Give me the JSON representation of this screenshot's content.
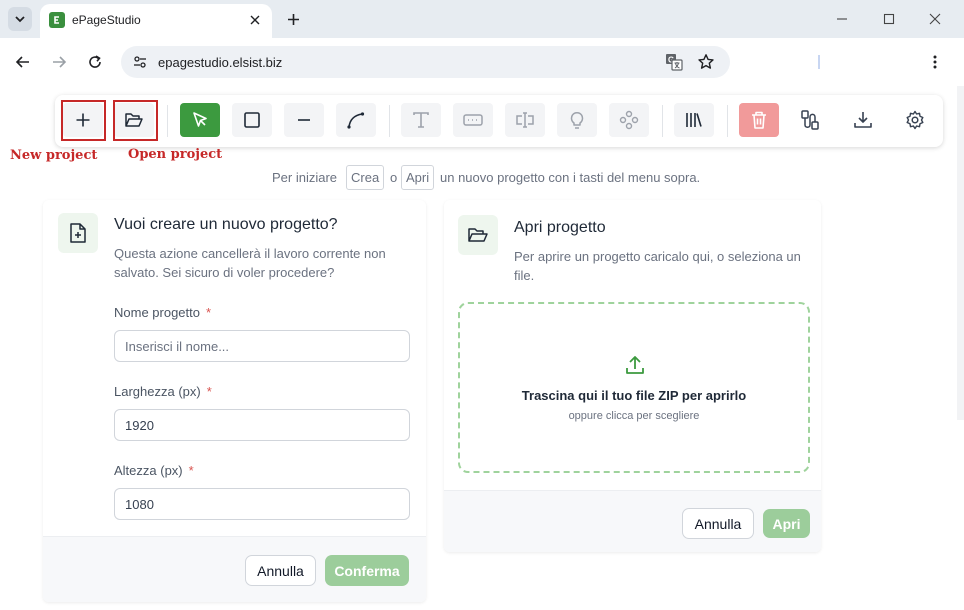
{
  "browser": {
    "tab": {
      "title": "ePageStudio"
    },
    "omnibox": {
      "url": "epagestudio.elsist.biz"
    }
  },
  "toolbar": {
    "tools": [
      {
        "name": "new-project",
        "icon": "plus-icon",
        "state": "normal"
      },
      {
        "name": "open-project",
        "icon": "folder-open-icon",
        "state": "normal"
      },
      {
        "name": "select-tool",
        "icon": "cursor-pointer-icon",
        "state": "active"
      },
      {
        "name": "rectangle-tool",
        "icon": "square-icon",
        "state": "normal"
      },
      {
        "name": "line-tool",
        "icon": "line-icon",
        "state": "normal"
      },
      {
        "name": "curve-tool",
        "icon": "curve-icon",
        "state": "normal"
      },
      {
        "name": "text-tool",
        "icon": "text-icon",
        "state": "disabled"
      },
      {
        "name": "input-field-tool",
        "icon": "input-field-icon",
        "state": "disabled"
      },
      {
        "name": "text-cursor-tool",
        "icon": "text-cursor-icon",
        "state": "disabled"
      },
      {
        "name": "lamp-tool",
        "icon": "lightbulb-icon",
        "state": "disabled"
      },
      {
        "name": "gamepad-tool",
        "icon": "gamepad-icon",
        "state": "disabled"
      },
      {
        "name": "library-tool",
        "icon": "library-icon",
        "state": "normal"
      },
      {
        "name": "delete-tool",
        "icon": "trash-icon",
        "state": "danger"
      },
      {
        "name": "connection-tool",
        "icon": "route-icon",
        "state": "normal"
      },
      {
        "name": "download-tool",
        "icon": "download-icon",
        "state": "normal"
      },
      {
        "name": "settings-tool",
        "icon": "gear-icon",
        "state": "normal"
      }
    ],
    "accent_color": "#3c9a3f",
    "danger_color": "#f19a9a"
  },
  "annotations": {
    "new_project": "New project",
    "open_project": "Open project"
  },
  "hint": {
    "prefix": "Per iniziare",
    "create_key": "Crea",
    "or": "o",
    "open_key": "Apri",
    "suffix": "un nuovo progetto con i tasti del menu sopra."
  },
  "new_project_card": {
    "title": "Vuoi creare un nuovo progetto?",
    "description": "Questa azione cancellerà il lavoro corrente non salvato. Sei sicuro di voler procedere?",
    "fields": [
      {
        "label": "Nome progetto",
        "required_mark": "*",
        "value": "",
        "placeholder": "Inserisci il nome..."
      },
      {
        "label": "Larghezza (px)",
        "required_mark": "*",
        "value": "1920",
        "placeholder": ""
      },
      {
        "label": "Altezza (px)",
        "required_mark": "*",
        "value": "1080",
        "placeholder": ""
      }
    ],
    "cancel_label": "Annulla",
    "confirm_label": "Conferma"
  },
  "open_project_card": {
    "title": "Apri progetto",
    "description": "Per aprire un progetto caricalo qui, o seleziona un file.",
    "dropzone_title": "Trascina qui il tuo file ZIP per aprirlo",
    "dropzone_subtitle": "oppure clicca per scegliere",
    "cancel_label": "Annulla",
    "open_label": "Apri"
  }
}
